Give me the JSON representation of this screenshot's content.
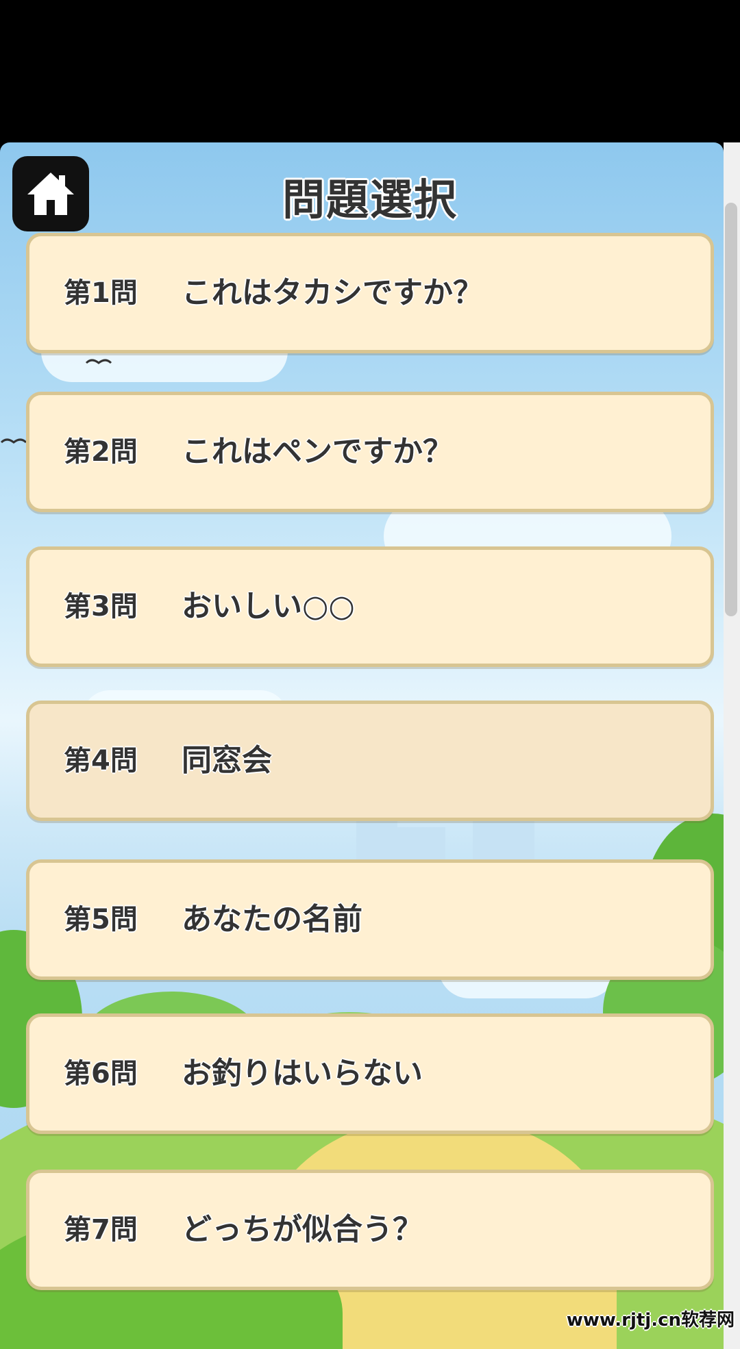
{
  "header": {
    "title": "問題選択",
    "home_icon": "home-icon"
  },
  "questions": [
    {
      "number": "第1問",
      "title": "これはタカシですか？",
      "selected": false
    },
    {
      "number": "第2問",
      "title": "これはペンですか？",
      "selected": false
    },
    {
      "number": "第3問",
      "title": "おいしい○○",
      "selected": false
    },
    {
      "number": "第4問",
      "title": "同窓会",
      "selected": true
    },
    {
      "number": "第5問",
      "title": "あなたの名前",
      "selected": false
    },
    {
      "number": "第6問",
      "title": "お釣りはいらない",
      "selected": false
    },
    {
      "number": "第7問",
      "title": "どっちが似合う？",
      "selected": false
    }
  ],
  "watermark": "www.rjtj.cn软荐网",
  "colors": {
    "button_fill": "#fff0d2",
    "button_border": "#d8c592",
    "home_button": "#111111",
    "text": "#333333"
  }
}
